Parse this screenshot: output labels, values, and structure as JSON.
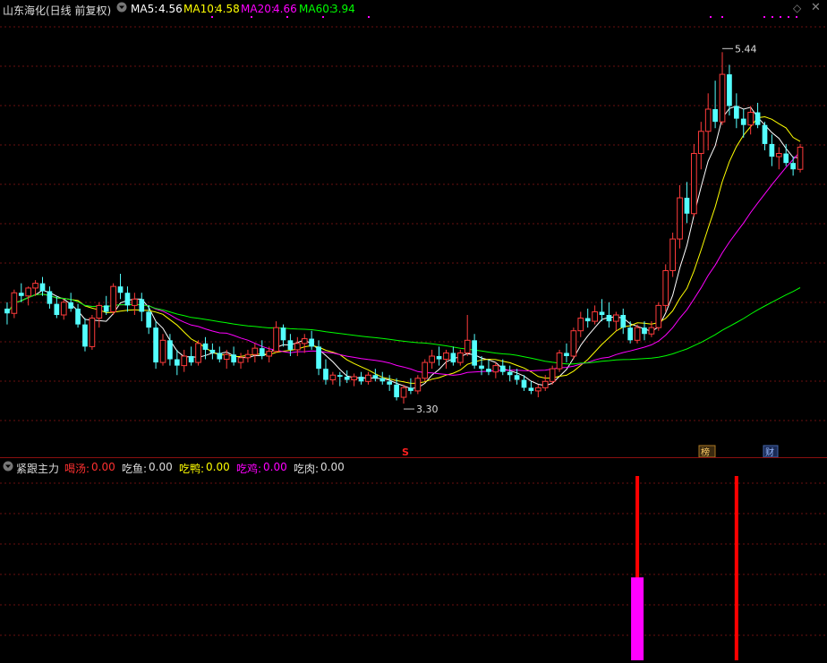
{
  "main": {
    "stock_title": "山东海化(日线 前复权)",
    "ma": [
      {
        "label": "MA5:",
        "value": "4.56",
        "color": "#ffffff"
      },
      {
        "label": "MA10:",
        "value": "4.58",
        "color": "#ffff00"
      },
      {
        "label": "MA20:",
        "value": "4.66",
        "color": "#ff00ff"
      },
      {
        "label": "MA60:",
        "value": "3.94",
        "color": "#00ff00"
      }
    ],
    "high_label": "5.44",
    "low_label": "3.30",
    "marker_s": "S",
    "marker_bang": "榜",
    "marker_cai": "财"
  },
  "indicator": {
    "name": "紧跟主力",
    "items": [
      {
        "label": "喝汤:",
        "value": "0.00",
        "color": "#ff3030"
      },
      {
        "label": "吃鱼:",
        "value": "0.00",
        "color": "#dddddd"
      },
      {
        "label": "吃鸭:",
        "value": "0.00",
        "color": "#ffff00"
      },
      {
        "label": "吃鸡:",
        "value": "0.00",
        "color": "#ff00ff"
      },
      {
        "label": "吃肉:",
        "value": "0.00",
        "color": "#dddddd"
      }
    ]
  },
  "chart_data": {
    "type": "candlestick",
    "price_range": [
      3.0,
      5.6
    ],
    "candles": [
      [
        3.82,
        3.86,
        3.72,
        3.79
      ],
      [
        3.79,
        3.94,
        3.76,
        3.92
      ],
      [
        3.92,
        3.98,
        3.86,
        3.9
      ],
      [
        3.9,
        3.96,
        3.84,
        3.95
      ],
      [
        3.95,
        4.0,
        3.9,
        3.98
      ],
      [
        3.98,
        4.02,
        3.9,
        3.93
      ],
      [
        3.93,
        3.96,
        3.82,
        3.85
      ],
      [
        3.85,
        3.9,
        3.76,
        3.78
      ],
      [
        3.78,
        3.88,
        3.75,
        3.86
      ],
      [
        3.86,
        3.92,
        3.8,
        3.82
      ],
      [
        3.82,
        3.85,
        3.7,
        3.72
      ],
      [
        3.72,
        3.76,
        3.55,
        3.58
      ],
      [
        3.58,
        3.78,
        3.56,
        3.76
      ],
      [
        3.76,
        3.86,
        3.7,
        3.84
      ],
      [
        3.84,
        3.9,
        3.78,
        3.8
      ],
      [
        3.8,
        3.98,
        3.78,
        3.96
      ],
      [
        3.96,
        4.04,
        3.88,
        3.92
      ],
      [
        3.92,
        3.96,
        3.8,
        3.84
      ],
      [
        3.84,
        3.92,
        3.78,
        3.88
      ],
      [
        3.88,
        3.92,
        3.74,
        3.8
      ],
      [
        3.8,
        3.84,
        3.66,
        3.7
      ],
      [
        3.7,
        3.74,
        3.44,
        3.48
      ],
      [
        3.48,
        3.66,
        3.46,
        3.62
      ],
      [
        3.62,
        3.66,
        3.46,
        3.5
      ],
      [
        3.5,
        3.56,
        3.4,
        3.46
      ],
      [
        3.46,
        3.56,
        3.42,
        3.52
      ],
      [
        3.52,
        3.58,
        3.46,
        3.48
      ],
      [
        3.48,
        3.62,
        3.46,
        3.6
      ],
      [
        3.6,
        3.64,
        3.5,
        3.56
      ],
      [
        3.56,
        3.6,
        3.5,
        3.54
      ],
      [
        3.54,
        3.58,
        3.48,
        3.5
      ],
      [
        3.5,
        3.56,
        3.44,
        3.53
      ],
      [
        3.53,
        3.58,
        3.46,
        3.48
      ],
      [
        3.48,
        3.54,
        3.44,
        3.51
      ],
      [
        3.51,
        3.56,
        3.48,
        3.53
      ],
      [
        3.53,
        3.6,
        3.48,
        3.57
      ],
      [
        3.57,
        3.62,
        3.5,
        3.52
      ],
      [
        3.52,
        3.58,
        3.48,
        3.55
      ],
      [
        3.55,
        3.74,
        3.54,
        3.7
      ],
      [
        3.7,
        3.72,
        3.58,
        3.62
      ],
      [
        3.62,
        3.66,
        3.52,
        3.56
      ],
      [
        3.56,
        3.64,
        3.52,
        3.6
      ],
      [
        3.6,
        3.66,
        3.54,
        3.63
      ],
      [
        3.63,
        3.68,
        3.56,
        3.58
      ],
      [
        3.58,
        3.62,
        3.4,
        3.44
      ],
      [
        3.44,
        3.5,
        3.34,
        3.37
      ],
      [
        3.37,
        3.42,
        3.34,
        3.4
      ],
      [
        3.4,
        3.42,
        3.33,
        3.39
      ],
      [
        3.39,
        3.43,
        3.35,
        3.37
      ],
      [
        3.37,
        3.41,
        3.33,
        3.39
      ],
      [
        3.39,
        3.42,
        3.34,
        3.36
      ],
      [
        3.36,
        3.42,
        3.34,
        3.4
      ],
      [
        3.4,
        3.44,
        3.36,
        3.38
      ],
      [
        3.38,
        3.42,
        3.34,
        3.36
      ],
      [
        3.36,
        3.4,
        3.3,
        3.34
      ],
      [
        3.34,
        3.38,
        3.24,
        3.26
      ],
      [
        3.26,
        3.34,
        3.22,
        3.32
      ],
      [
        3.32,
        3.38,
        3.28,
        3.3
      ],
      [
        3.3,
        3.4,
        3.28,
        3.38
      ],
      [
        3.38,
        3.5,
        3.36,
        3.48
      ],
      [
        3.48,
        3.56,
        3.44,
        3.52
      ],
      [
        3.52,
        3.58,
        3.46,
        3.5
      ],
      [
        3.5,
        3.56,
        3.44,
        3.54
      ],
      [
        3.54,
        3.58,
        3.46,
        3.48
      ],
      [
        3.48,
        3.56,
        3.46,
        3.54
      ],
      [
        3.54,
        3.78,
        3.52,
        3.62
      ],
      [
        3.62,
        3.66,
        3.44,
        3.46
      ],
      [
        3.46,
        3.52,
        3.4,
        3.44
      ],
      [
        3.44,
        3.5,
        3.4,
        3.42
      ],
      [
        3.42,
        3.48,
        3.38,
        3.46
      ],
      [
        3.46,
        3.5,
        3.4,
        3.42
      ],
      [
        3.42,
        3.46,
        3.36,
        3.4
      ],
      [
        3.4,
        3.44,
        3.34,
        3.37
      ],
      [
        3.37,
        3.4,
        3.3,
        3.32
      ],
      [
        3.32,
        3.36,
        3.28,
        3.3
      ],
      [
        3.3,
        3.34,
        3.26,
        3.32
      ],
      [
        3.32,
        3.4,
        3.3,
        3.36
      ],
      [
        3.36,
        3.46,
        3.34,
        3.44
      ],
      [
        3.44,
        3.56,
        3.42,
        3.54
      ],
      [
        3.54,
        3.6,
        3.48,
        3.52
      ],
      [
        3.52,
        3.7,
        3.5,
        3.68
      ],
      [
        3.68,
        3.8,
        3.64,
        3.76
      ],
      [
        3.76,
        3.82,
        3.7,
        3.74
      ],
      [
        3.74,
        3.84,
        3.72,
        3.8
      ],
      [
        3.8,
        3.88,
        3.74,
        3.78
      ],
      [
        3.78,
        3.86,
        3.7,
        3.74
      ],
      [
        3.74,
        3.8,
        3.68,
        3.78
      ],
      [
        3.78,
        3.82,
        3.66,
        3.7
      ],
      [
        3.7,
        3.74,
        3.6,
        3.62
      ],
      [
        3.62,
        3.72,
        3.6,
        3.7
      ],
      [
        3.7,
        3.74,
        3.62,
        3.66
      ],
      [
        3.66,
        3.74,
        3.64,
        3.7
      ],
      [
        3.7,
        3.86,
        3.68,
        3.84
      ],
      [
        3.84,
        4.1,
        3.8,
        4.06
      ],
      [
        4.06,
        4.3,
        4.02,
        4.26
      ],
      [
        4.26,
        4.6,
        4.2,
        4.52
      ],
      [
        4.52,
        4.62,
        4.36,
        4.42
      ],
      [
        4.42,
        4.86,
        4.4,
        4.8
      ],
      [
        4.8,
        5.0,
        4.7,
        4.94
      ],
      [
        4.94,
        5.18,
        4.82,
        5.08
      ],
      [
        5.08,
        5.26,
        4.96,
        5.0
      ],
      [
        5.0,
        5.44,
        4.98,
        5.3
      ],
      [
        5.3,
        5.36,
        5.04,
        5.1
      ],
      [
        5.1,
        5.18,
        4.96,
        5.02
      ],
      [
        5.02,
        5.08,
        4.9,
        4.98
      ],
      [
        4.98,
        5.1,
        4.92,
        5.06
      ],
      [
        5.06,
        5.12,
        4.96,
        4.98
      ],
      [
        4.98,
        5.0,
        4.82,
        4.86
      ],
      [
        4.86,
        4.92,
        4.72,
        4.78
      ],
      [
        4.78,
        4.84,
        4.7,
        4.8
      ],
      [
        4.8,
        4.86,
        4.72,
        4.74
      ],
      [
        4.74,
        4.78,
        4.66,
        4.7
      ],
      [
        4.7,
        4.86,
        4.68,
        4.84
      ]
    ],
    "indicator_bars": [
      {
        "index": 89,
        "value": 1.0,
        "color": "#ff0000"
      },
      {
        "index": 89,
        "value": 0.45,
        "color": "#ff00ff"
      },
      {
        "index": 103,
        "value": 1.0,
        "color": "#ff0000"
      }
    ]
  }
}
